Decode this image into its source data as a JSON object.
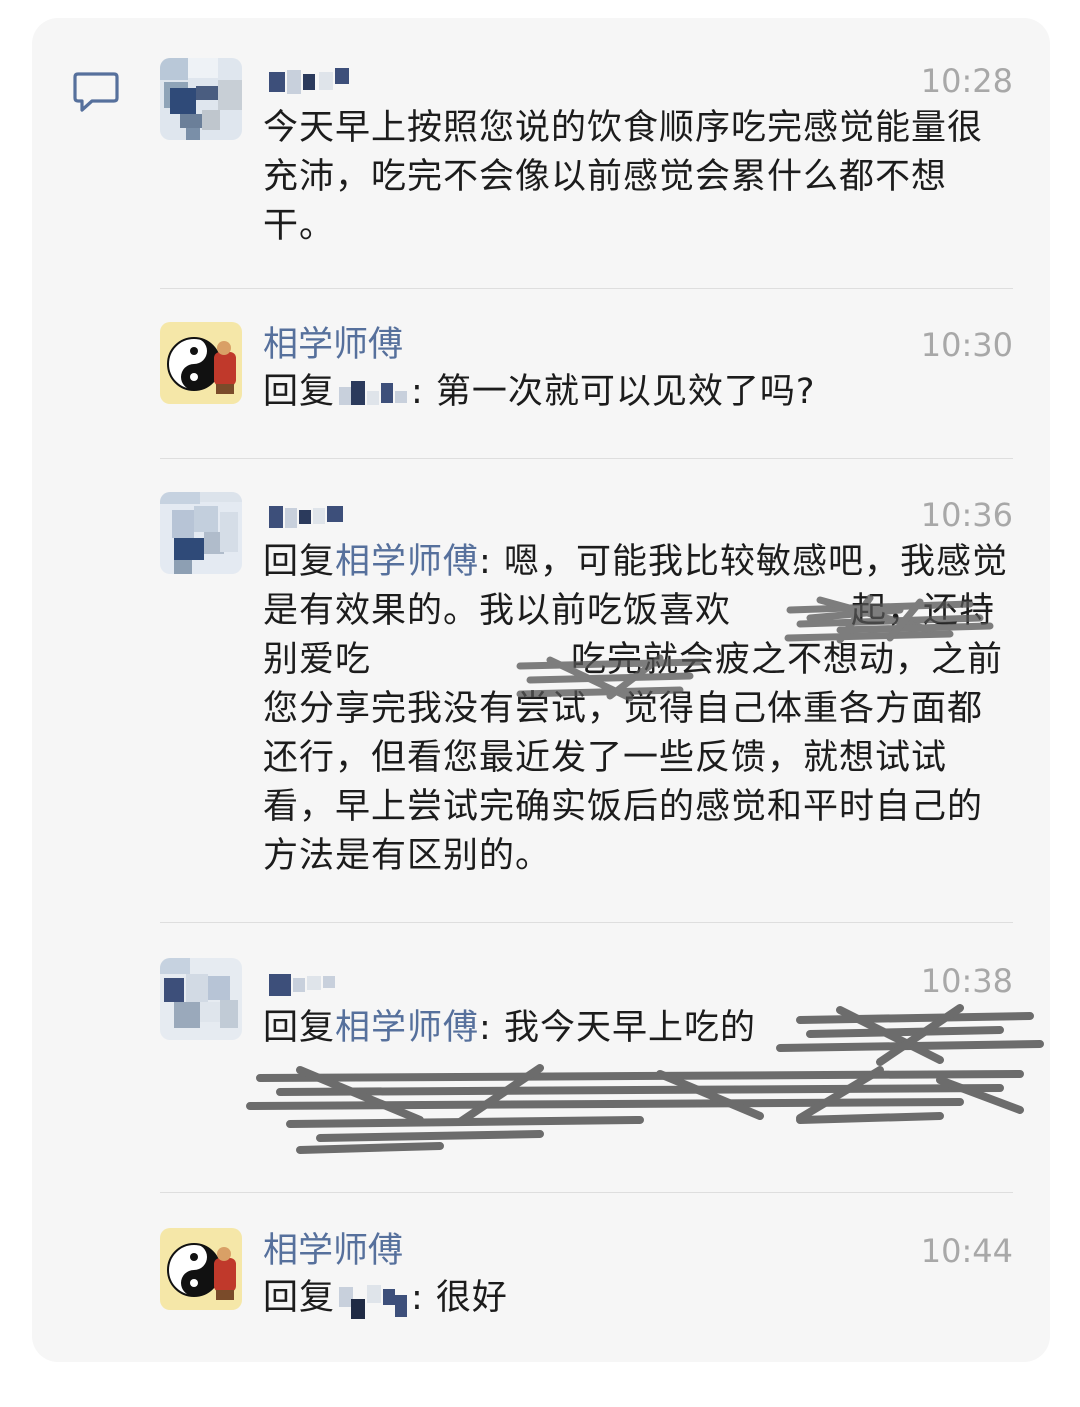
{
  "messages": [
    {
      "time": "10:28",
      "text": "今天早上按照您说的饮食顺序吃完感觉能量很充沛，吃完不会像以前感觉会累什么都不想干。"
    },
    {
      "name": "相学师傅",
      "time": "10:30",
      "reply_prefix": "回复",
      "text": ": 第一次就可以见效了吗?"
    },
    {
      "time": "10:36",
      "reply_prefix": "回复",
      "reply_to": "相学师傅",
      "line1": ": 嗯，可能我比较敏感吧，我感觉是有效果的。我以前吃饭喜欢",
      "line2": "起，还特别爱吃",
      "line3": "吃完就会疲之不想动，之前您分享完我没有尝试，觉得自己体重各方面都还行，但看您最近发了一些反馈，就想试试看，早上尝试完确实饭后的感觉和平时自己的方法是有区别的。"
    },
    {
      "time": "10:38",
      "reply_prefix": "回复",
      "reply_to": "相学师傅",
      "text": ": 我今天早上吃的"
    },
    {
      "name": "相学师傅",
      "time": "10:44",
      "reply_prefix": "回复",
      "text": ": 很好"
    }
  ],
  "icons": {
    "comment": "comment-bubble-icon",
    "avatar_master": "yin-yang-avatar",
    "avatar_user": "pixelated-avatar"
  },
  "colors": {
    "name": "#56709c",
    "time": "#a8a8a8",
    "text": "#1c1c1c",
    "card": "#f6f6f6"
  }
}
